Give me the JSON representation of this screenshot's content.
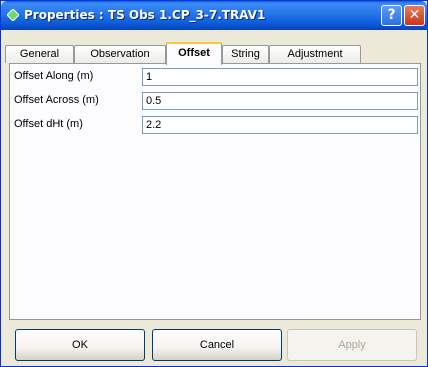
{
  "window": {
    "title": "Properties : TS Obs 1.CP_3-7.TRAV1",
    "help_label": "?",
    "close_label": "✕"
  },
  "tabs": [
    {
      "label": "General"
    },
    {
      "label": "Observation"
    },
    {
      "label": "Offset"
    },
    {
      "label": "String"
    },
    {
      "label": "Adjustment"
    }
  ],
  "active_tab": "Offset",
  "fields": [
    {
      "label": "Offset Along (m)",
      "value": "1"
    },
    {
      "label": "Offset Across (m)",
      "value": "0.5"
    },
    {
      "label": "Offset dHt (m)",
      "value": "2.2"
    }
  ],
  "buttons": {
    "ok": "OK",
    "cancel": "Cancel",
    "apply": "Apply"
  },
  "colors": {
    "titlebar": "#2574ea",
    "dialog_bg": "#ece9d8",
    "active_tab_accent": "#ffc83c"
  }
}
